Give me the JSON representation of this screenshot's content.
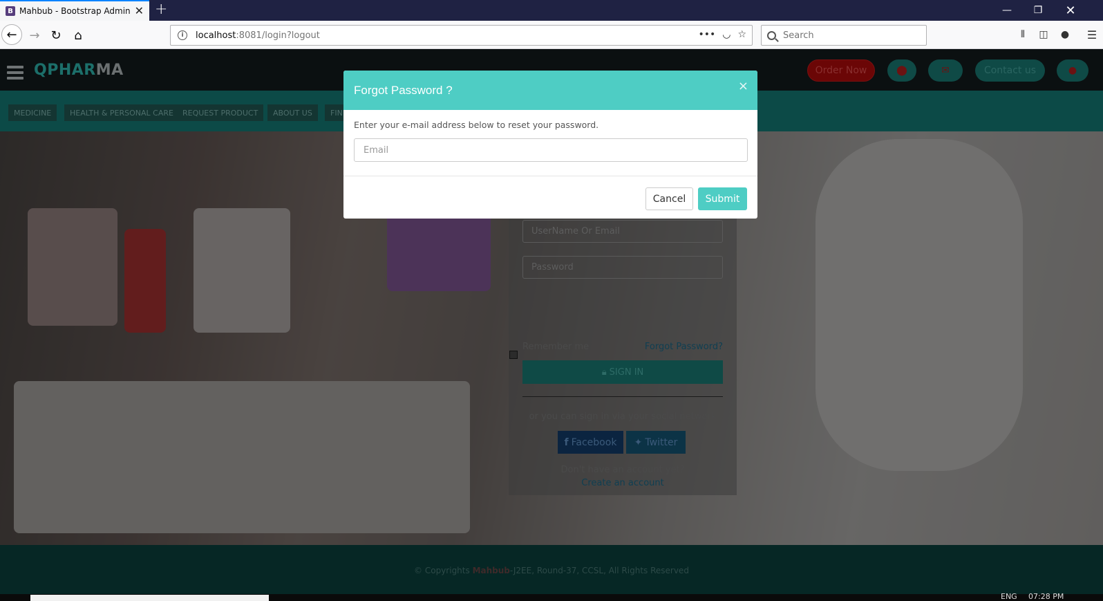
{
  "browser": {
    "tab_favicon": "B",
    "tab_title": "Mahbub - Bootstrap Admin Template",
    "url_host": "localhost",
    "url_rest": ":8081/login?logout",
    "search_placeholder": "Search",
    "icons": [
      "back-icon",
      "forward-icon",
      "reload-icon",
      "home-icon",
      "info-icon",
      "more-icon",
      "pocket-icon",
      "star-icon",
      "library-icon",
      "sidebar-icon",
      "account-icon",
      "menu-icon",
      "minimize-icon",
      "restore-icon",
      "close-icon"
    ]
  },
  "site": {
    "logo_a": "QPHAR",
    "logo_b": "MA",
    "header_buttons": {
      "order_now": "Order Now",
      "contact_us": "Contact us"
    },
    "menu": [
      "MEDICINE",
      "HEALTH & PERSONAL CARE",
      "REQUEST PRODUCT",
      "ABOUT US",
      "FIN"
    ],
    "colors": {
      "accent": "#4ecdc4",
      "header_dark": "#0b1011",
      "menu_teal": "#0c4a47"
    }
  },
  "login": {
    "username_placeholder": "UserName Or Email",
    "password_placeholder": "Password",
    "remember_me": "Remember me",
    "forgot_password": "Forgot Password?",
    "sign_in": "SIGN IN",
    "social_text": "or you can sign in via your social network",
    "facebook": "Facebook",
    "twitter": "Twitter",
    "no_account": "Don't have an account yet?",
    "create_account": "Create an account"
  },
  "modal": {
    "title": "Forgot Password ?",
    "message": "Enter your e-mail address below to reset your password.",
    "email_placeholder": "Email",
    "cancel": "Cancel",
    "submit": "Submit",
    "close_symbol": "×"
  },
  "footer": {
    "prefix": "© Copyrights ",
    "author": "Mahbub",
    "suffix": "-J2EE, Round-37, CCSL, All Rights Reserved"
  },
  "taskbar": {
    "lang": "ENG",
    "time": "07:28 PM"
  }
}
